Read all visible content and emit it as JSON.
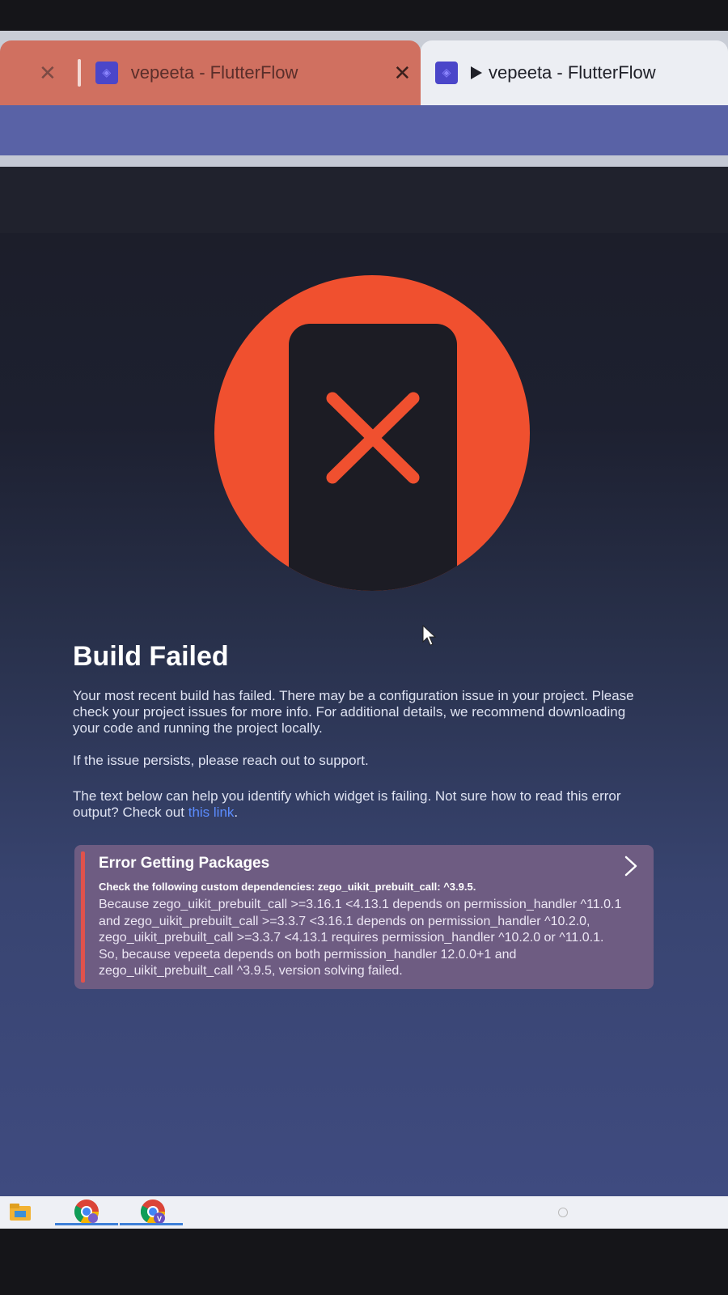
{
  "browser": {
    "tabs": [
      {
        "title": "vepeeta - FlutterFlow",
        "active": false
      },
      {
        "title": "vepeeta - FlutterFlow",
        "active": true,
        "playing": true
      }
    ]
  },
  "build_error": {
    "title": "Build Failed",
    "paragraphs": [
      "Your most recent build has failed. There may be a configuration issue in your project. Please check your project issues for more info. For additional details, we recommend downloading your code and running the project locally.",
      "If the issue persists, please reach out to support."
    ],
    "help_text_before_link": "The text below can help you identify which widget is failing. Not sure how to read this error output? Check out ",
    "help_link_label": "this link",
    "help_text_after_link": ".",
    "error_card": {
      "title": "Error Getting Packages",
      "subtitle": "Check the following custom dependencies: zego_uikit_prebuilt_call: ^3.9.5.",
      "lines": [
        "Because zego_uikit_prebuilt_call >=3.16.1 <4.13.1 depends on permission_handler ^11.0.1",
        "and zego_uikit_prebuilt_call >=3.3.7 <3.16.1 depends on permission_handler ^10.2.0,",
        "zego_uikit_prebuilt_call >=3.3.7 <4.13.1 requires permission_handler ^10.2.0 or ^11.0.1.",
        "So, because vepeeta depends on both permission_handler 12.0.0+1 and",
        "zego_uikit_prebuilt_call ^3.9.5, version solving failed."
      ]
    }
  },
  "colors": {
    "accent_red": "#f0502f",
    "link_blue": "#5b8cff",
    "error_card_bg": "#6e5c82",
    "error_accent": "#e0524b"
  },
  "icons": {
    "hero": "build-failed-phone-x-icon",
    "expand": "chevron-right-icon",
    "tab_close": "close-icon",
    "favicon": "flutterflow-logo-icon"
  },
  "taskbar": {
    "apps": [
      {
        "name": "file-explorer-icon"
      },
      {
        "name": "chrome-profile-icon"
      },
      {
        "name": "chrome-profile-v-icon",
        "badge": "V"
      }
    ]
  }
}
